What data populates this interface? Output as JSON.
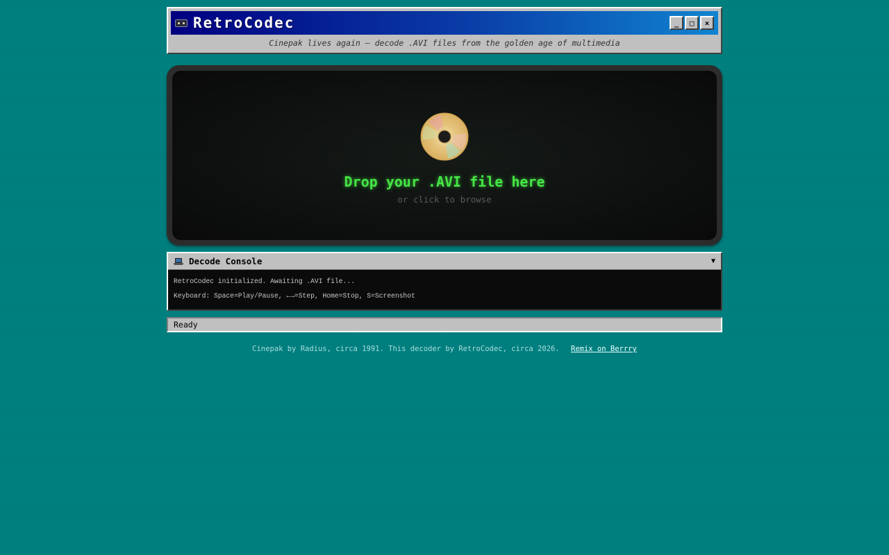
{
  "window": {
    "title": "RetroCodec",
    "subtitle": "Cinepak lives again — decode .AVI files from the golden age of multimedia",
    "controls": {
      "minimize": "_",
      "maximize": "□",
      "close": "×"
    }
  },
  "dropzone": {
    "icon": "cd-disc-icon",
    "title": "Drop your .AVI file here",
    "subtitle": "or click to browse"
  },
  "console": {
    "icon": "laptop-icon",
    "title": "Decode Console",
    "toggle": "▼",
    "lines": [
      "RetroCodec initialized. Awaiting .AVI file...",
      "Keyboard: Space=Play/Pause, ←→=Step, Home=Stop, S=Screenshot"
    ]
  },
  "status": {
    "text": "Ready"
  },
  "footer": {
    "credit": "Cinepak by Radius, circa 1991. This decoder by RetroCodec, circa 2026.",
    "link": "Remix on Berrry"
  },
  "colors": {
    "desktop": "#008080",
    "titlebar_start": "#000080",
    "titlebar_end": "#1084d0",
    "accent_green": "#44e644"
  }
}
